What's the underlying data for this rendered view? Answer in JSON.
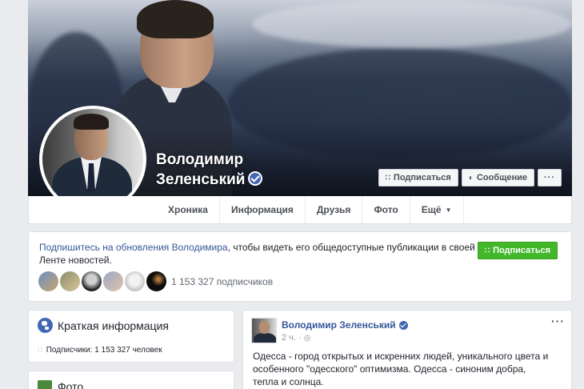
{
  "profile": {
    "name_line1": "Володимир",
    "name_line2": "Зеленський",
    "verified": true
  },
  "cover_actions": {
    "subscribe_label": "Подписаться",
    "message_label": "Сообщение",
    "more_label": "···"
  },
  "nav": {
    "tabs": [
      {
        "label": "Хроника"
      },
      {
        "label": "Информация"
      },
      {
        "label": "Друзья"
      },
      {
        "label": "Фото"
      },
      {
        "label": "Ещё"
      }
    ]
  },
  "subscribe_box": {
    "link_text": "Подпишитесь на обновления Володимира",
    "rest_text": ", чтобы видеть его общедоступные публикации в своей Ленте новостей.",
    "button_label": "Подписаться",
    "subscribers_count": "1 153 327 подписчиков"
  },
  "intro": {
    "title": "Краткая информация",
    "followers_label": "Подписчики: 1 153 327 человек"
  },
  "photos": {
    "title": "Фото"
  },
  "post": {
    "author": "Володимир Зеленський",
    "time": "2 ч. · ",
    "more_label": "···",
    "text": "Одесса - город открытых и искренних людей, уникального цвета и особенного \"одесского\" оптимизма. Одесса - синоним добра, тепла и солнца."
  },
  "colors": {
    "link_blue": "#365899",
    "brand_blue": "#4267b2",
    "subscribe_green": "#42b72a",
    "page_bg": "#e9ebee"
  }
}
